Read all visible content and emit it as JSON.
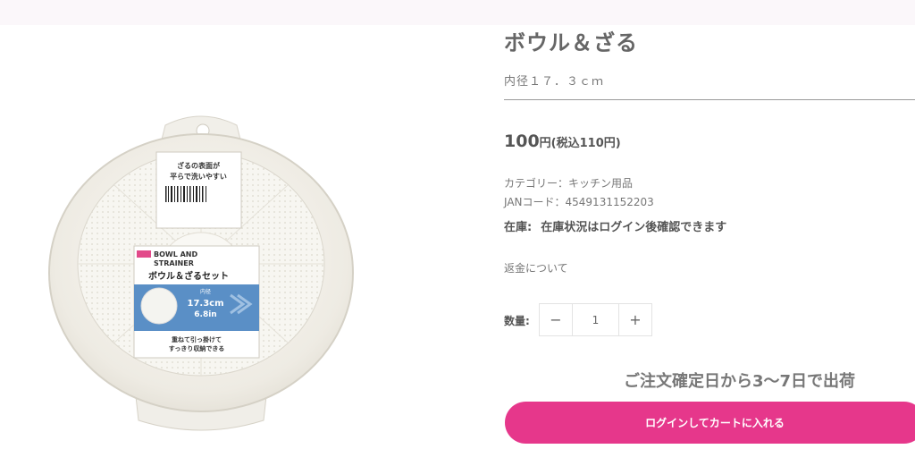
{
  "product": {
    "title": "ボウル＆ざる",
    "subtitle": "内径１７．３ｃｍ",
    "price_main": "100",
    "price_suffix": "円(税込110円)",
    "category": "カテゴリー：キッチン用品",
    "jan": "JANコード：4549131152203",
    "stock_label": "在庫:",
    "stock_text": "在庫状況はログイン後確認できます",
    "refund_link": "返金について"
  },
  "package": {
    "label_line1": "ざるの表面が",
    "label_line2": "平らで洗いやすい",
    "name_en_1": "BOWL AND",
    "name_en_2": "STRAINER",
    "name_jp": "ボウル＆ざるセット",
    "inner_label": "内径",
    "size_cm": "17.3cm",
    "size_in": "6.8in",
    "feature_1": "重ねて引っ掛けて",
    "feature_2": "すっきり収納できる"
  },
  "quantity": {
    "label": "数量:",
    "minus": "−",
    "value": "1",
    "plus": "+"
  },
  "shipping": {
    "note": "ご注文確定日から3〜7日で出荷"
  },
  "cart": {
    "button_label": "ログインしてカートに入れる"
  },
  "colors": {
    "accent": "#e6378b",
    "package_blue": "#5a8fc6"
  }
}
